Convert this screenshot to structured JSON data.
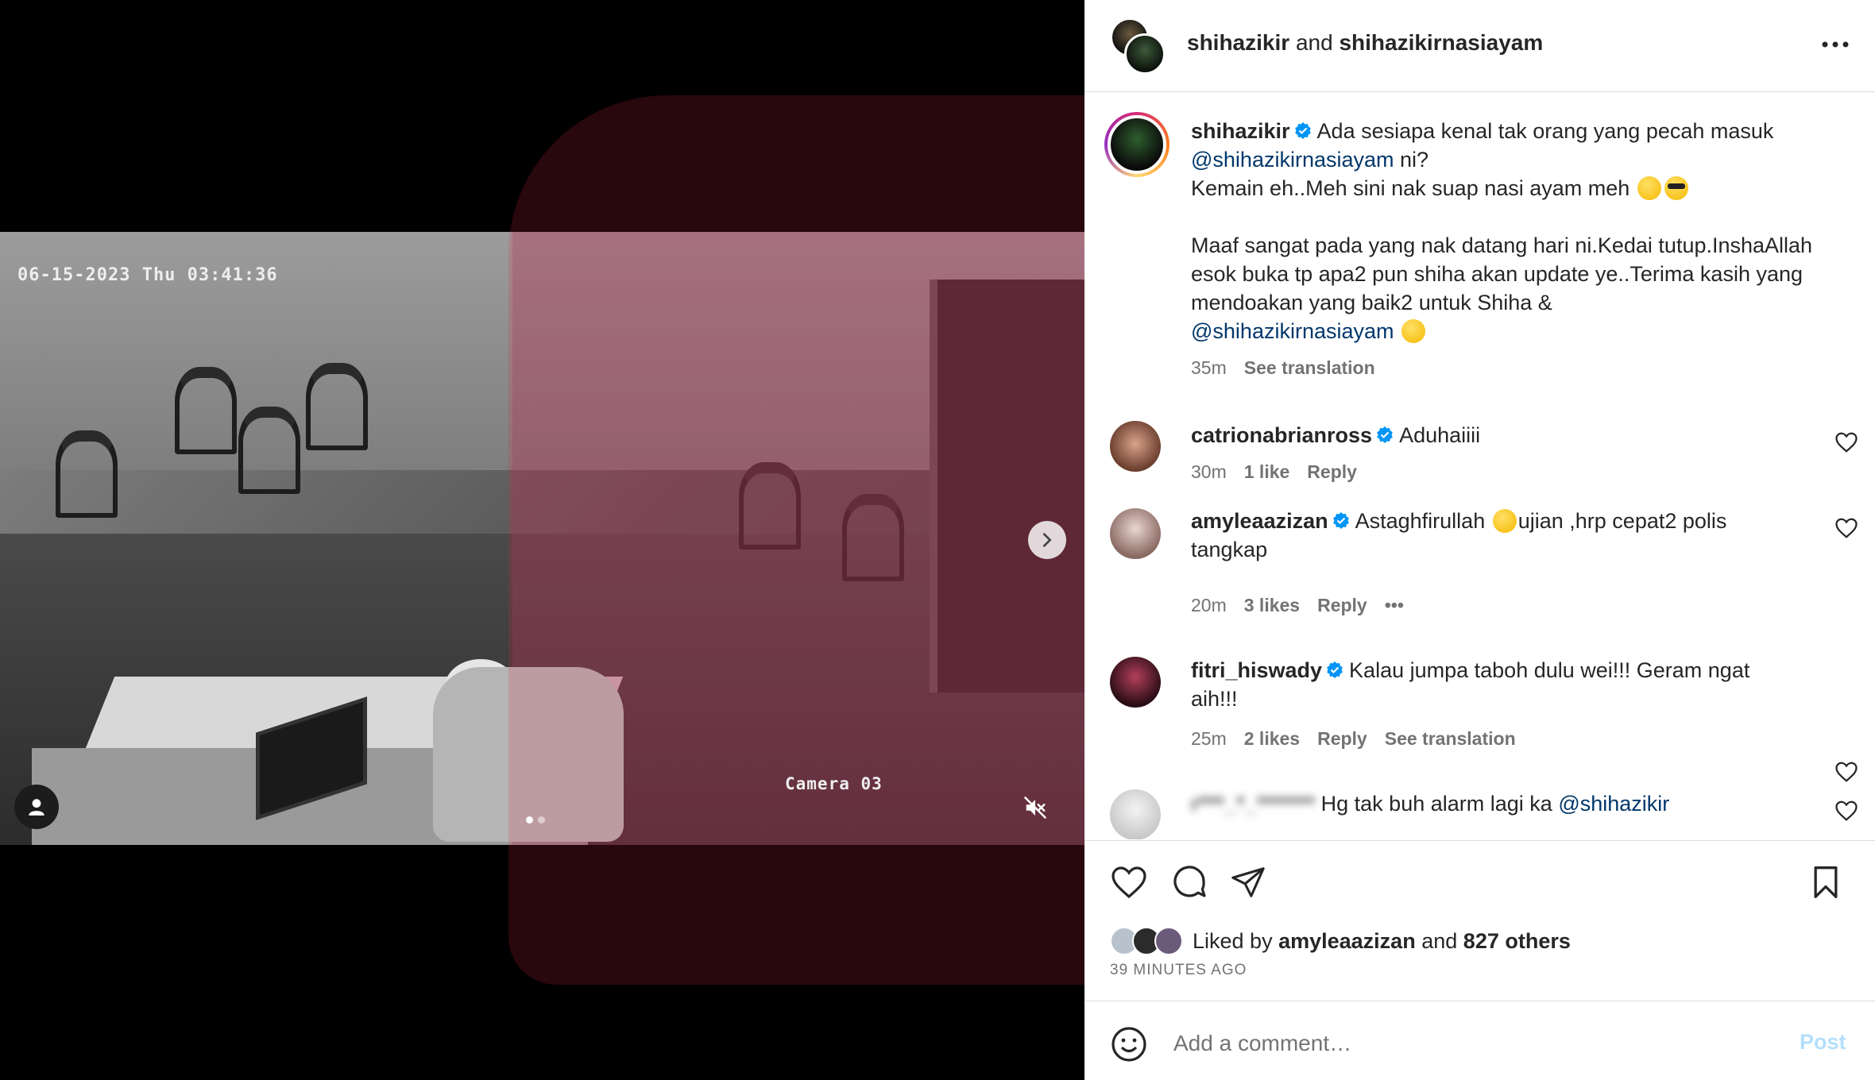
{
  "media": {
    "cctv_timestamp": "06-15-2023 Thu 03:41:36",
    "cctv_camera": "Camera 03",
    "carousel_count": 2,
    "carousel_active": 1,
    "icons": {
      "next": "chevron-right-icon",
      "tags": "user-tag-icon",
      "mute": "speaker-muted-icon"
    }
  },
  "header": {
    "user1": "shihazikir",
    "joiner": "and",
    "user2": "shihazikirnasiayam"
  },
  "caption": {
    "username": "shihazikir",
    "line1": "Ada sesiapa kenal tak orang yang pecah masuk",
    "mention1": "@shihazikirnasiayam",
    "line1_end": " ni?",
    "line2": "Kemain eh..Meh sini nak suap nasi ayam meh",
    "para2": "Maaf sangat pada yang nak datang hari ni.Kedai tutup.InshaAllah esok buka tp apa2 pun shiha akan update ye..Terima kasih yang mendoakan yang baik2 untuk Shiha &",
    "mention2": "@shihazikirnasiayam",
    "time": "35m",
    "see_translation": "See translation"
  },
  "comments": [
    {
      "username": "catrionabrianross",
      "text": "Aduhaiiii",
      "time": "30m",
      "likes": "1 like",
      "reply": "Reply"
    },
    {
      "username": "amyleaazizan",
      "text_before": "Astaghfirullah",
      "text_after": "ujian ,hrp cepat2 polis tangkap",
      "time": "20m",
      "likes": "3 likes",
      "reply": "Reply",
      "more": "•••"
    },
    {
      "username": "fitri_hiswady",
      "text": "Kalau jumpa taboh dulu wei!!! Geram ngat aih!!!",
      "time": "25m",
      "likes": "2 likes",
      "reply": "Reply",
      "see_translation": "See translation"
    },
    {
      "username": "r***_*_*******",
      "text": "Hg tak buh alarm lagi ka",
      "mention": "@shihazikir"
    }
  ],
  "likes": {
    "prefix": "Liked by",
    "user": "amyleaazizan",
    "joiner": "and",
    "others": "827 others",
    "ago": "39 MINUTES AGO"
  },
  "composer": {
    "placeholder": "Add a comment…",
    "post_label": "Post"
  },
  "colors": {
    "link": "#00376b",
    "verified": "#0095f6",
    "post_disabled": "#b2dffc",
    "muted_text": "#737373"
  }
}
